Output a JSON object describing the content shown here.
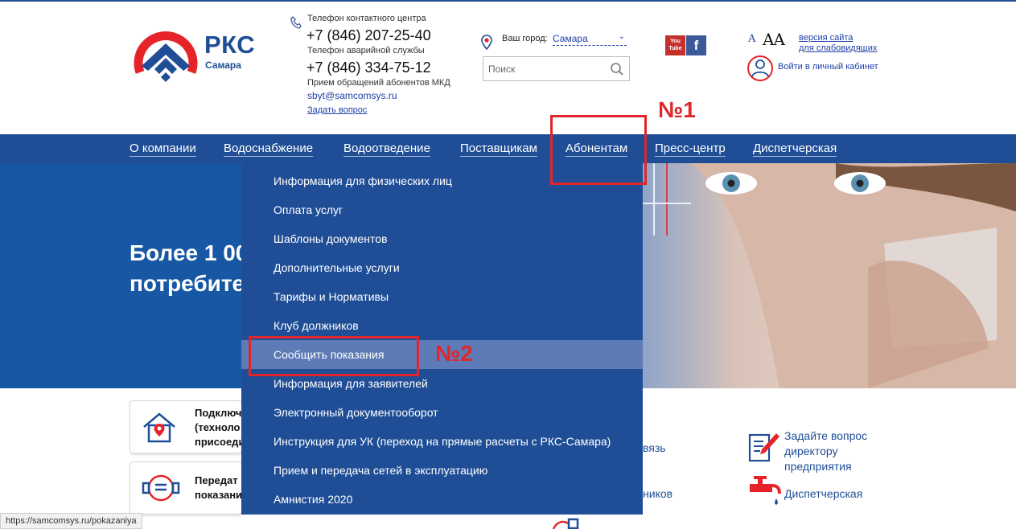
{
  "logo": {
    "title": "РКС",
    "subtitle": "Самара"
  },
  "contacts": {
    "contact_center_label": "Телефон контактного центра",
    "contact_center_phone": "+7 (846) 207-25-40",
    "emergency_label": "Телефон аварийной службы",
    "emergency_phone": "+7 (846) 334-75-12",
    "mkd_label": "Прием обращений абонентов МКД",
    "email": "sbyt@samcomsys.ru",
    "ask_question": "Задать вопрос"
  },
  "city": {
    "label": "Ваш город:",
    "value": "Самара"
  },
  "search": {
    "placeholder": "Поиск"
  },
  "social": {
    "youtube_line1": "You",
    "youtube_line2": "Tube",
    "facebook": "f"
  },
  "accessibility": {
    "font_small": "A",
    "font_large": "AA",
    "link_line1": "версия сайта",
    "link_line2": "для слабовидящих"
  },
  "cabinet": {
    "label": "Войти в личный кабинет"
  },
  "nav": [
    {
      "label": "О компании"
    },
    {
      "label": "Водоснабжение"
    },
    {
      "label": "Водоотведение"
    },
    {
      "label": "Поставщикам"
    },
    {
      "label": "Абонентам"
    },
    {
      "label": "Пресс-центр"
    },
    {
      "label": "Диспетчерская"
    }
  ],
  "hero": {
    "line1": "Более 1 00",
    "line2": "потребите"
  },
  "dropdown": [
    {
      "label": "Информация для физических лиц"
    },
    {
      "label": "Оплата услуг"
    },
    {
      "label": "Шаблоны документов"
    },
    {
      "label": "Дополнительные услуги"
    },
    {
      "label": "Тарифы и Нормативы"
    },
    {
      "label": "Клуб должников"
    },
    {
      "label": "Сообщить показания"
    },
    {
      "label": "Информация для заявителей"
    },
    {
      "label": "Электронный документооборот"
    },
    {
      "label": "Инструкция для УК (переход на прямые расчеты с РКС-Самара)"
    },
    {
      "label": "Прием и передача сетей в эксплуатацию"
    },
    {
      "label": "Амнистия 2020"
    }
  ],
  "annotations": {
    "label1": "№1",
    "label2": "№2",
    "color": "#e0262b"
  },
  "tiles": [
    {
      "line1": "Подключ",
      "line2": "(техноло",
      "line3": "присоеди"
    },
    {
      "line1": "Передат",
      "line2": "показани"
    }
  ],
  "partials": {
    "svyaz": "вязь",
    "nikov": "ников"
  },
  "side_links": {
    "director_line1": "Задайте вопрос",
    "director_line2": "директору",
    "director_line3": "предприятия",
    "dispatch": "Диспетчерская"
  },
  "status_bar": {
    "url": "https://samcomsys.ru/pokazaniya"
  },
  "colors": {
    "brand_blue": "#1f4e97",
    "brand_red": "#e52329",
    "active_item": "#5d7bb6"
  }
}
